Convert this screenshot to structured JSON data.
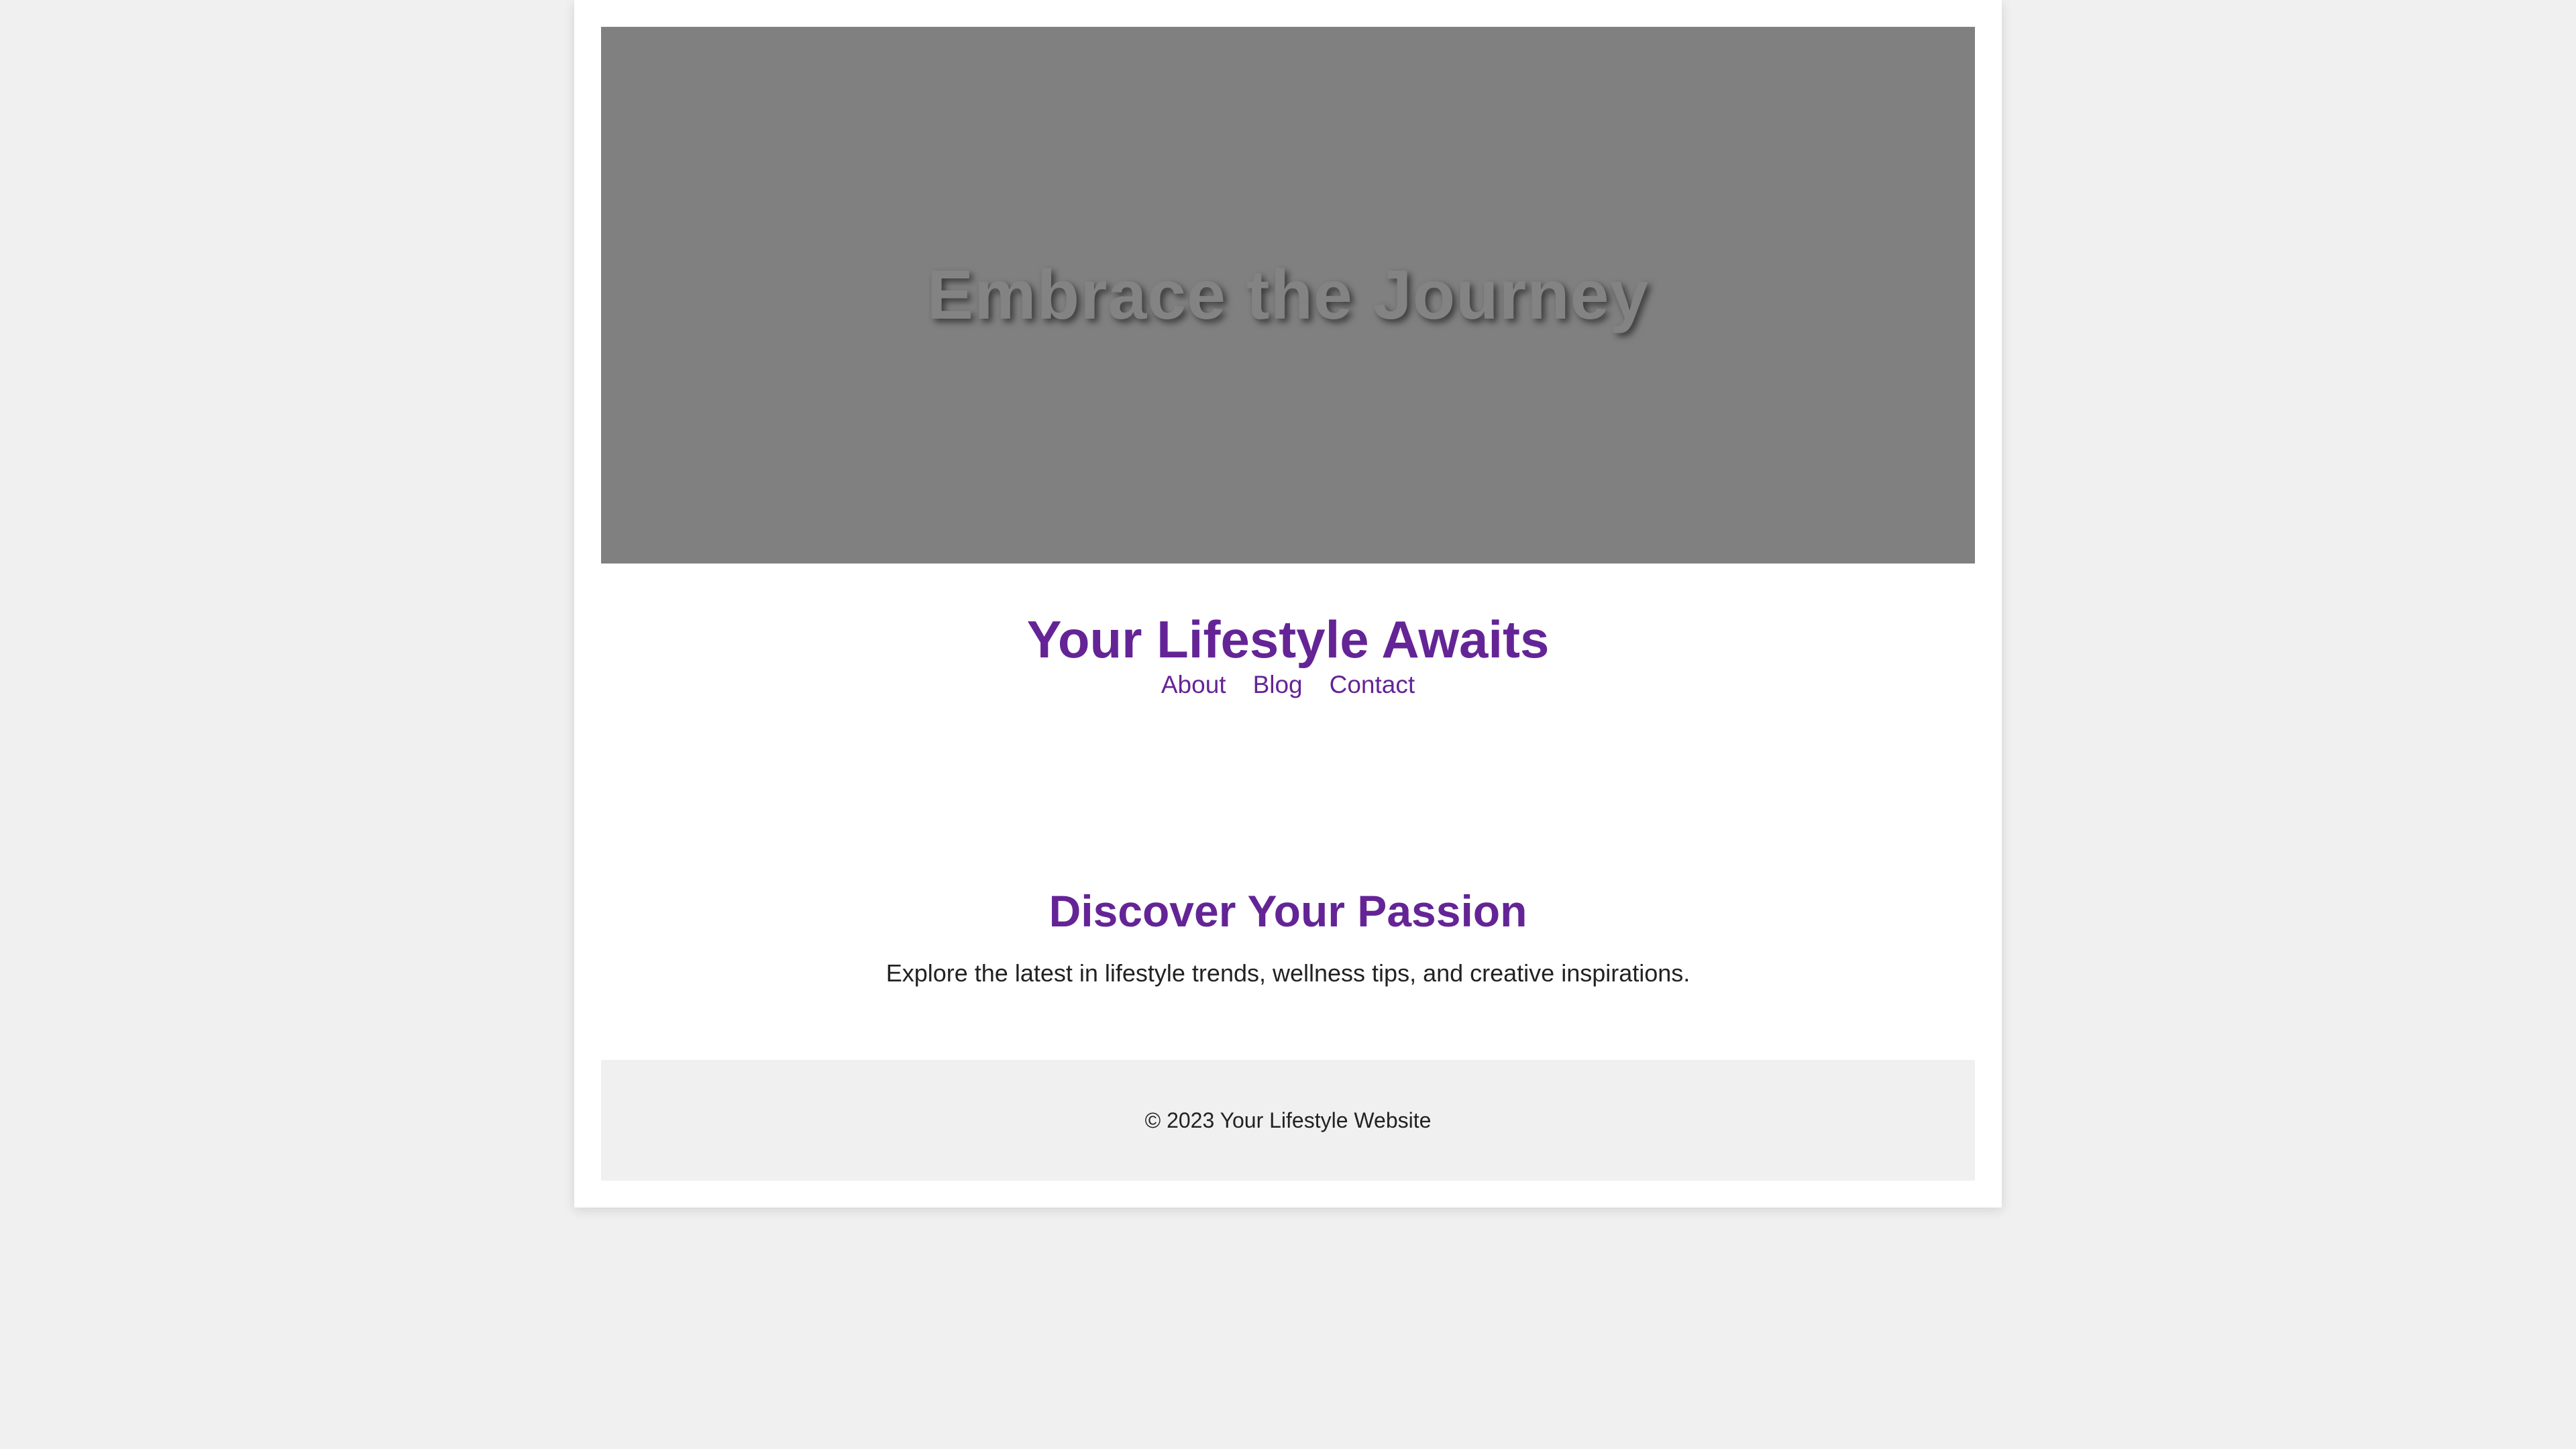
{
  "hero": {
    "title": "Embrace the Journey"
  },
  "header": {
    "title": "Your Lifestyle Awaits",
    "nav": [
      {
        "label": "About"
      },
      {
        "label": "Blog"
      },
      {
        "label": "Contact"
      }
    ]
  },
  "main": {
    "heading": "Discover Your Passion",
    "text": "Explore the latest in lifestyle trends, wellness tips, and creative inspirations."
  },
  "footer": {
    "text": "© 2023 Your Lifestyle Website"
  },
  "colors": {
    "accent": "#642496",
    "page_background": "#f0f0f0",
    "hero_background": "#808080",
    "card_background": "#ffffff",
    "body_text": "#222222"
  }
}
